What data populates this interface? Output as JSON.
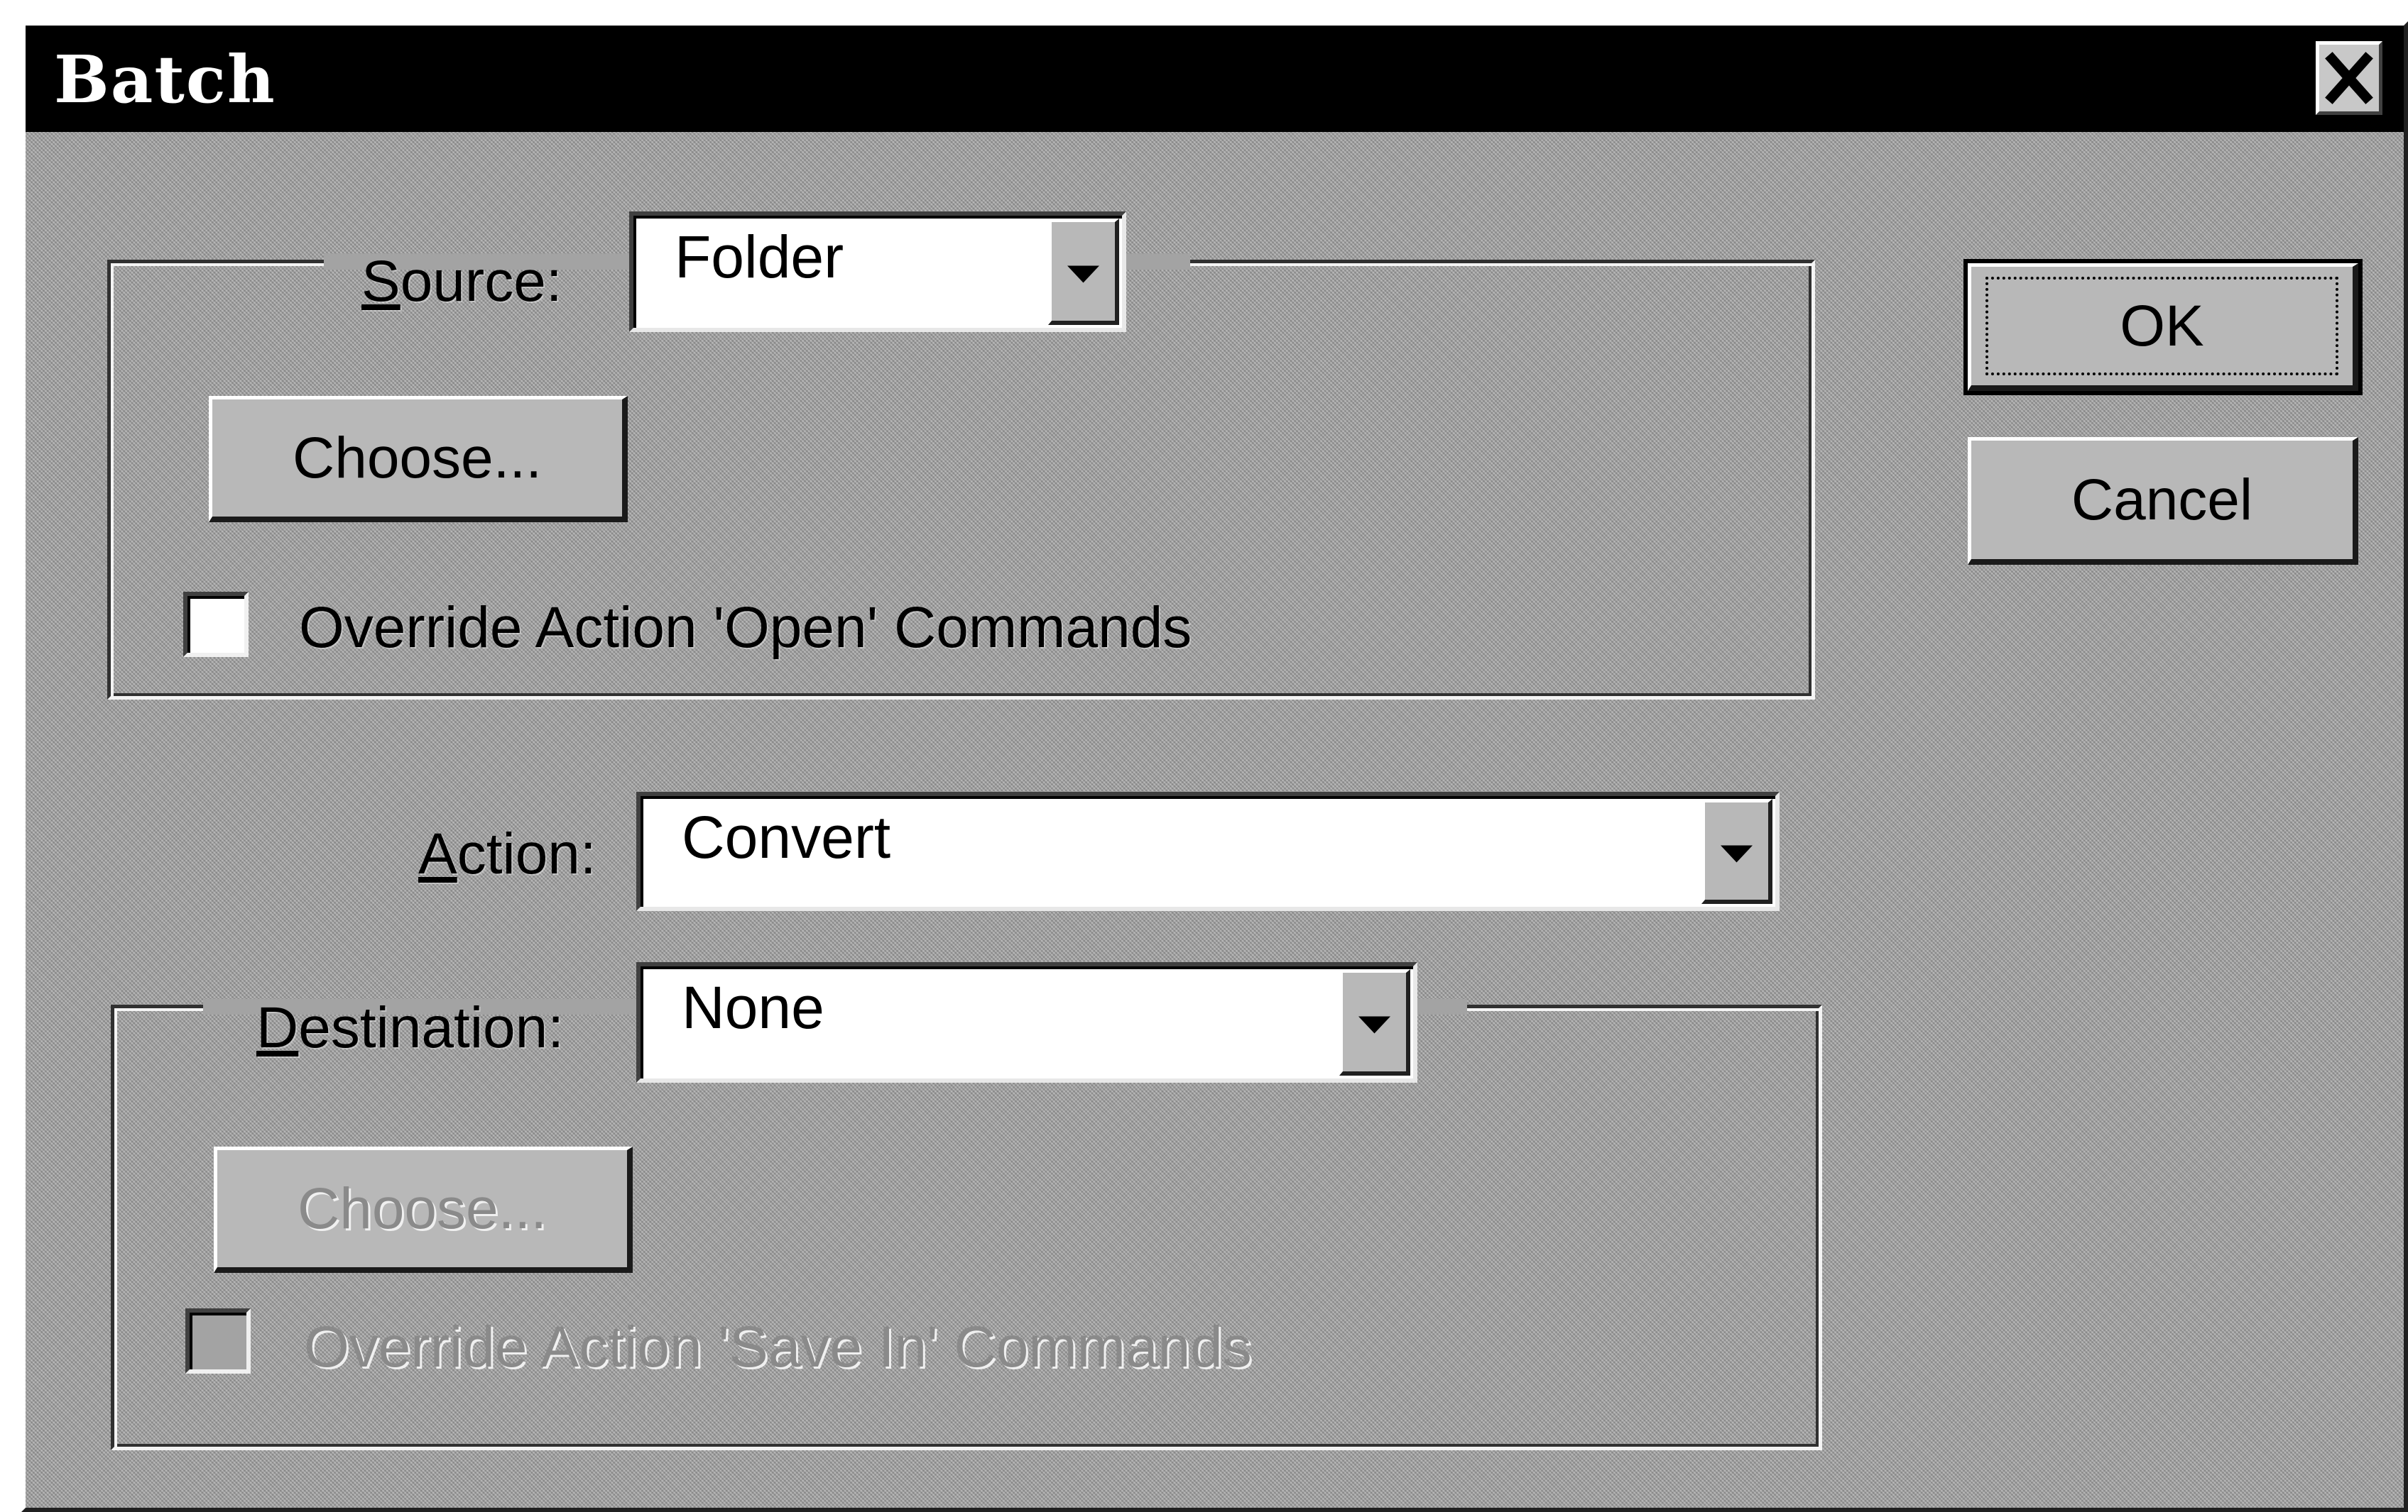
{
  "window": {
    "title": "Batch",
    "close_icon": "close-icon"
  },
  "source": {
    "label_hotkey": "S",
    "label_rest": "ource:",
    "value": "Folder",
    "choose_label": "Choose...",
    "override_label": "Override Action 'Open' Commands",
    "override_checked": false
  },
  "action": {
    "label_hotkey": "A",
    "label_rest": "ction:",
    "value": "Convert"
  },
  "destination": {
    "label_hotkey": "D",
    "label_rest": "estination:",
    "value": "None",
    "choose_label": "Choose...",
    "choose_enabled": false,
    "override_label": "Override Action 'Save In' Commands",
    "override_checked": false,
    "override_enabled": false
  },
  "buttons": {
    "ok_label": "OK",
    "cancel_label": "Cancel"
  },
  "colors": {
    "face": "#a3a3a3",
    "titlebar": "#000000",
    "field": "#ffffff",
    "disabled_text": "#8a8a8a"
  }
}
